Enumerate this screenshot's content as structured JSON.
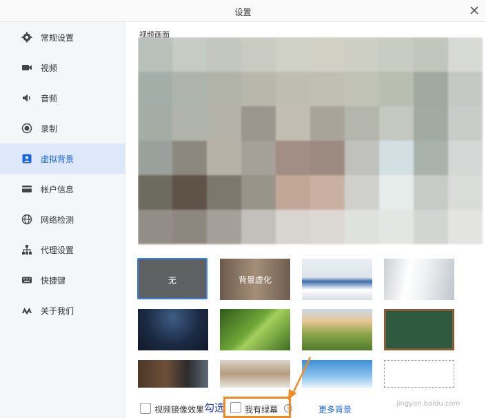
{
  "window": {
    "title": "设置"
  },
  "sidebar": {
    "items": [
      {
        "label": "常规设置"
      },
      {
        "label": "视频"
      },
      {
        "label": "音频"
      },
      {
        "label": "录制"
      },
      {
        "label": "虚拟背景"
      },
      {
        "label": "帐户信息"
      },
      {
        "label": "网络检测"
      },
      {
        "label": "代理设置"
      },
      {
        "label": "快捷键"
      },
      {
        "label": "关于我们"
      }
    ],
    "active_index": 4
  },
  "main": {
    "preview_label": "视频画面",
    "backgrounds": [
      {
        "label": "无",
        "selected": true
      },
      {
        "label": "背景虚化"
      },
      {
        "label": ""
      },
      {
        "label": ""
      },
      {
        "label": ""
      },
      {
        "label": ""
      },
      {
        "label": ""
      },
      {
        "label": ""
      },
      {
        "label": ""
      },
      {
        "label": ""
      },
      {
        "label": ""
      },
      {
        "label": ""
      }
    ]
  },
  "footer": {
    "mirror_label": "视频镜像效果",
    "green_screen_label": "我有绿幕",
    "more_backgrounds": "更多背景"
  },
  "annotation": {
    "text": "勾选"
  },
  "watermark": {
    "text": "jingyan.baidu.com"
  },
  "colors": {
    "accent": "#1a63d8",
    "active_bg": "#dde9fb",
    "highlight": "#f08a24"
  }
}
